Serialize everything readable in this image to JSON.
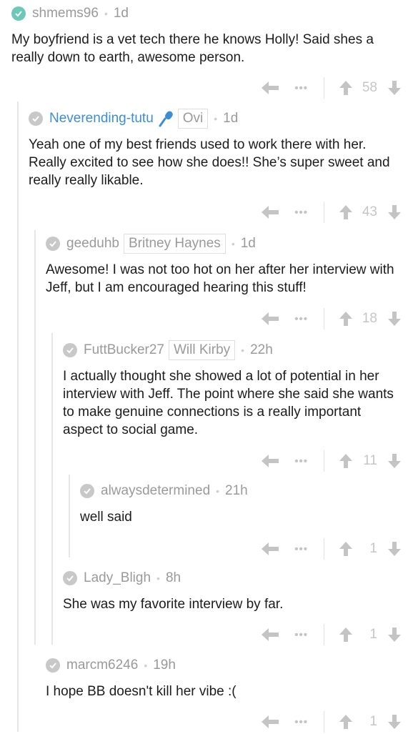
{
  "comments": [
    {
      "username": "shmems96",
      "flair": "",
      "time": "1d",
      "text": "My boyfriend is a vet tech there he knows Holly! Said shes a really down to earth, awesome person.",
      "score": "58"
    },
    {
      "username": "Neverending-tutu",
      "flair": "Ovi",
      "time": "1d",
      "text": "Yeah one of my best friends used to work there with her. Really excited to see how she does!! She’s super sweet and really really likable.",
      "score": "43"
    },
    {
      "username": "geeduhb",
      "flair": "Britney Haynes",
      "time": "1d",
      "text": "Awesome! I was not too hot on her after her interview with Jeff, but I am encouraged hearing this stuff!",
      "score": "18"
    },
    {
      "username": "FuttBucker27",
      "flair": "Will Kirby",
      "time": "22h",
      "text": "I actually thought she showed a lot of potential in her interview with Jeff. The point where she said she wants to make genuine connections is a really important aspect to social game.",
      "score": "11"
    },
    {
      "username": "alwaysdetermined",
      "flair": "",
      "time": "21h",
      "text": "well said",
      "score": "1"
    },
    {
      "username": "Lady_Bligh",
      "flair": "",
      "time": "8h",
      "text": "She was my favorite interview by far.",
      "score": "1"
    },
    {
      "username": "marcm6246",
      "flair": "",
      "time": "19h",
      "text": "I hope BB doesn't kill her vibe :(",
      "score": "1"
    }
  ],
  "icons": {
    "check": "checkmark-circle-icon",
    "mic": "microphone-icon",
    "reply": "reply-arrow-icon",
    "more": "more-dots-icon",
    "upvote": "upvote-arrow-icon",
    "downvote": "downvote-arrow-icon"
  },
  "colors": {
    "op_check": "#6cc9b8",
    "highlight_user": "#3c8ed4",
    "mic": "#3c8ed4",
    "muted": "#9a9a9a"
  }
}
